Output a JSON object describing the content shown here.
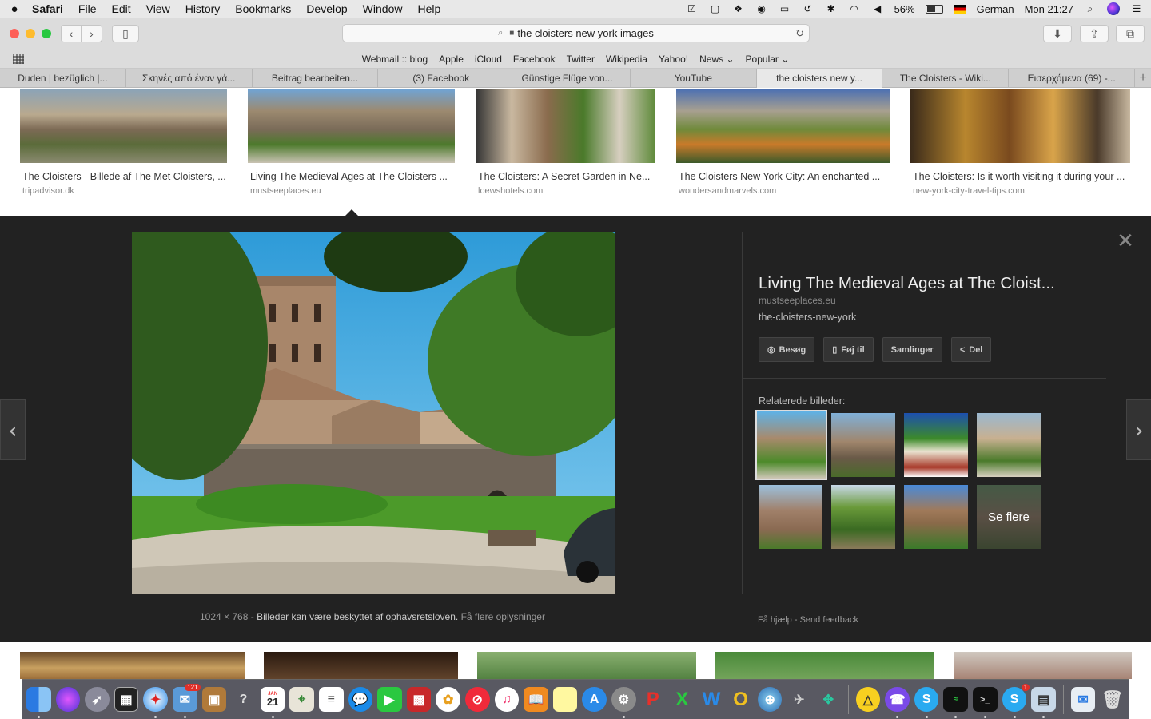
{
  "menubar": {
    "app": "Safari",
    "items": [
      "File",
      "Edit",
      "View",
      "History",
      "Bookmarks",
      "Develop",
      "Window",
      "Help"
    ],
    "battery": "56%",
    "input_lang": "German",
    "clock": "Mon 21:27"
  },
  "address_bar": {
    "query": "the cloisters new york  images"
  },
  "bookmarks": [
    "Webmail :: blog",
    "Apple",
    "iCloud",
    "Facebook",
    "Twitter",
    "Wikipedia",
    "Yahoo!",
    "News ⌄",
    "Popular ⌄"
  ],
  "tabs": [
    "Duden | bezüglich |...",
    "Σκηνές από έναν γά...",
    "Beitrag bearbeiten...",
    "(3) Facebook",
    "Günstige Flüge von...",
    "YouTube",
    "the cloisters new y...",
    "The Cloisters - Wiki...",
    "Εισερχόμενα (69) -..."
  ],
  "results_top": [
    {
      "caption": "The Cloisters - Billede af The Met Cloisters, ...",
      "source": "tripadvisor.dk"
    },
    {
      "caption": "Living The Medieval Ages at The Cloisters ...",
      "source": "mustseeplaces.eu"
    },
    {
      "caption": "The Cloisters: A Secret Garden in Ne...",
      "source": "loewshotels.com"
    },
    {
      "caption": "The Cloisters New York City: An enchanted ...",
      "source": "wondersandmarvels.com"
    },
    {
      "caption": "The Cloisters: Is it worth visiting it during your ...",
      "source": "new-york-city-travel-tips.com"
    }
  ],
  "preview": {
    "title": "Living The Medieval Ages at The Cloist...",
    "site": "mustseeplaces.eu",
    "name": "the-cloisters-new-york",
    "buttons": {
      "visit": "Besøg",
      "save": "Føj til",
      "collections": "Samlinger",
      "share": "Del"
    },
    "related_label": "Relaterede billeder:",
    "see_more": "Se flere",
    "dimensions": "1024 × 768",
    "separator": "-",
    "copyright": "Billeder kan være beskyttet af ophavsretsloven.",
    "more_info": "Få flere oplysninger",
    "help": "Få hjælp",
    "footer_sep": "-",
    "feedback": "Send feedback"
  },
  "dock": {
    "calendar_month": "JAN",
    "calendar_day": "21",
    "mail_badge": "121",
    "skype_badge": "1"
  },
  "colors": {
    "panel_bg": "#222222",
    "menubar_bg": "#e8e8e8",
    "active_tab": "#e8e8e8"
  }
}
